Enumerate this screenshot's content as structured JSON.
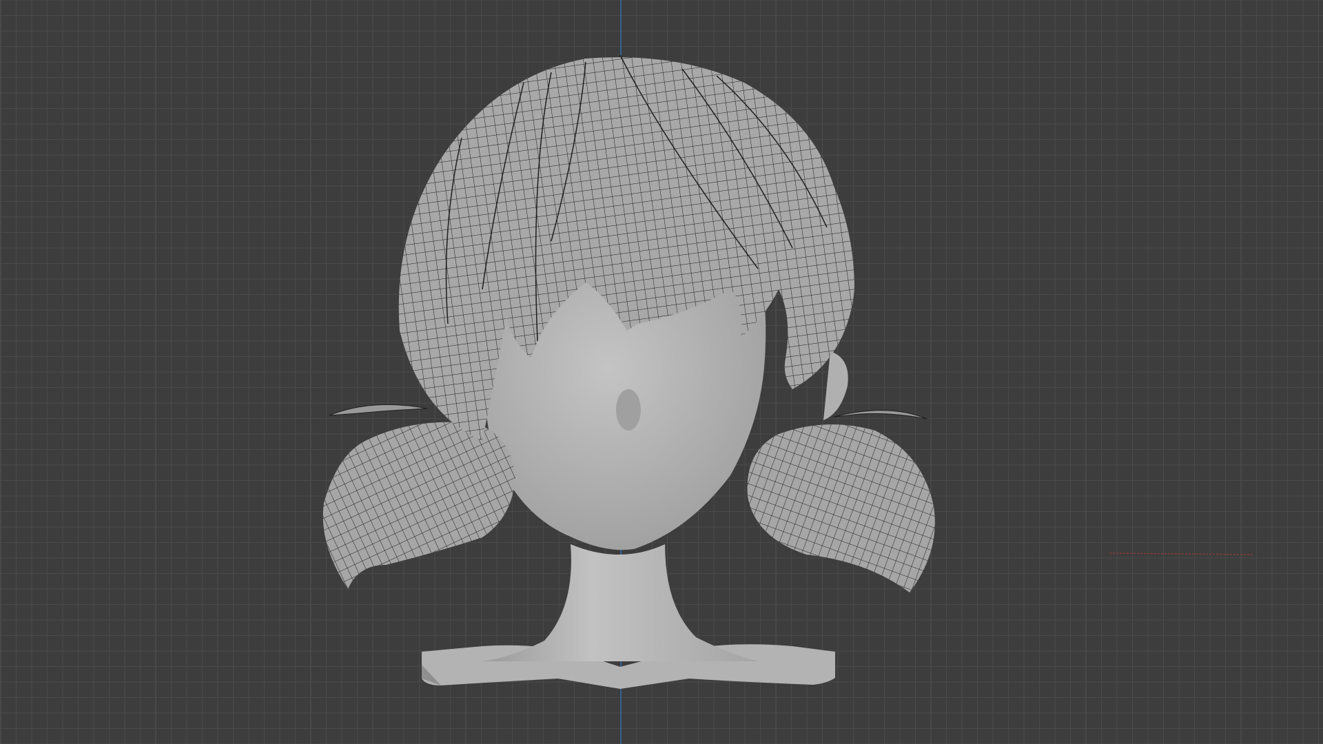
{
  "viewport": {
    "mode": "3D Viewport",
    "view": "front-orthographic",
    "background_color": "#3d3d3d",
    "grid_color": "#4a4a4a",
    "grid_major_color": "#525252",
    "axis_z_color": "#2f6fb0",
    "axis_x_color": "#8a3a3a"
  },
  "model": {
    "object": "stylized-head-with-pigtail-hair",
    "shading": "solid-with-wireframe-overlay",
    "skin_color": "#b9b9b9",
    "hair_color": "#a6a6a6",
    "wire_color": "#1e1e1e"
  }
}
